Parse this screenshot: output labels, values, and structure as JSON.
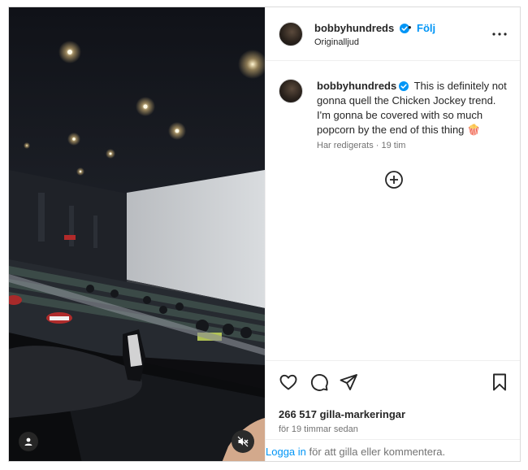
{
  "post": {
    "username": "bobbyhundreds",
    "follow_separator": "•",
    "follow_label": "Följ",
    "audio_label": "Originalljud",
    "caption": "This is definitely not gonna quell the Chicken Jockey trend. I'm gonna be covered with so much popcorn by the end of this thing 🍿",
    "edited_label": "Har redigerats",
    "meta_separator": "·",
    "caption_age": "19 tim",
    "likes": "266 517 gilla-markeringar",
    "posted_time": "för 19 timmar sedan"
  },
  "login_prompt": {
    "link_label": "Logga in",
    "rest": " för att gilla eller kommentera."
  },
  "icons": {
    "verified": "verified-badge-icon",
    "more": "more-options-icon",
    "load_comments": "plus-circle-icon",
    "like": "heart-icon",
    "comment": "comment-icon",
    "share": "send-icon",
    "save": "bookmark-icon",
    "tags": "user-tag-icon",
    "mute": "muted-speaker-icon"
  },
  "colors": {
    "link_blue": "#0095f6",
    "verified_blue": "#0095f6",
    "text_primary": "#262626",
    "text_secondary": "#737373",
    "divider": "#efefef"
  }
}
